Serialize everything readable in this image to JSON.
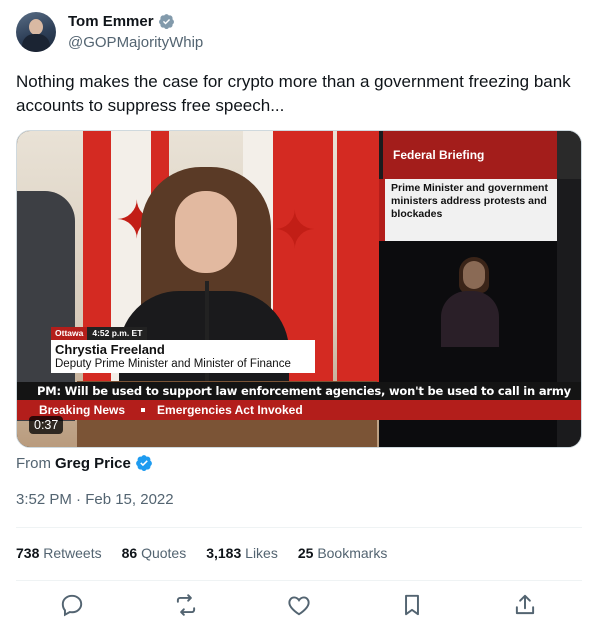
{
  "author": {
    "name": "Tom Emmer",
    "handle": "@GOPMajorityWhip"
  },
  "tweet": {
    "text": "Nothing makes the case for crypto more than a government freezing bank accounts to suppress free speech..."
  },
  "media": {
    "panel_title": "Federal Briefing",
    "panel_text": "Prime Minister and government ministers address protests and blockades",
    "lower_third_location": "Ottawa",
    "lower_third_time": "4:52 p.m. ET",
    "lower_third_name": "Chrystia Freeland",
    "lower_third_title": "Deputy Prime Minister and Minister of Finance",
    "ticker": "PM: Will be used to support law enforcement agencies, won't be used to call in army",
    "breaking_label": "Breaking News",
    "breaking_text": "Emergencies Act Invoked",
    "duration": "0:37"
  },
  "attribution": {
    "prefix": "From",
    "name": "Greg Price"
  },
  "timestamp": "3:52 PM · Feb 15, 2022",
  "stats": {
    "retweets_count": "738",
    "retweets_label": "Retweets",
    "quotes_count": "86",
    "quotes_label": "Quotes",
    "likes_count": "3,183",
    "likes_label": "Likes",
    "bookmarks_count": "25",
    "bookmarks_label": "Bookmarks"
  },
  "colors": {
    "verified_grey": "#829aab",
    "verified_blue": "#1d9bf0",
    "cbc_red": "#b31e1b"
  },
  "icons": [
    "reply-icon",
    "retweet-icon",
    "like-icon",
    "bookmark-icon",
    "share-icon"
  ]
}
